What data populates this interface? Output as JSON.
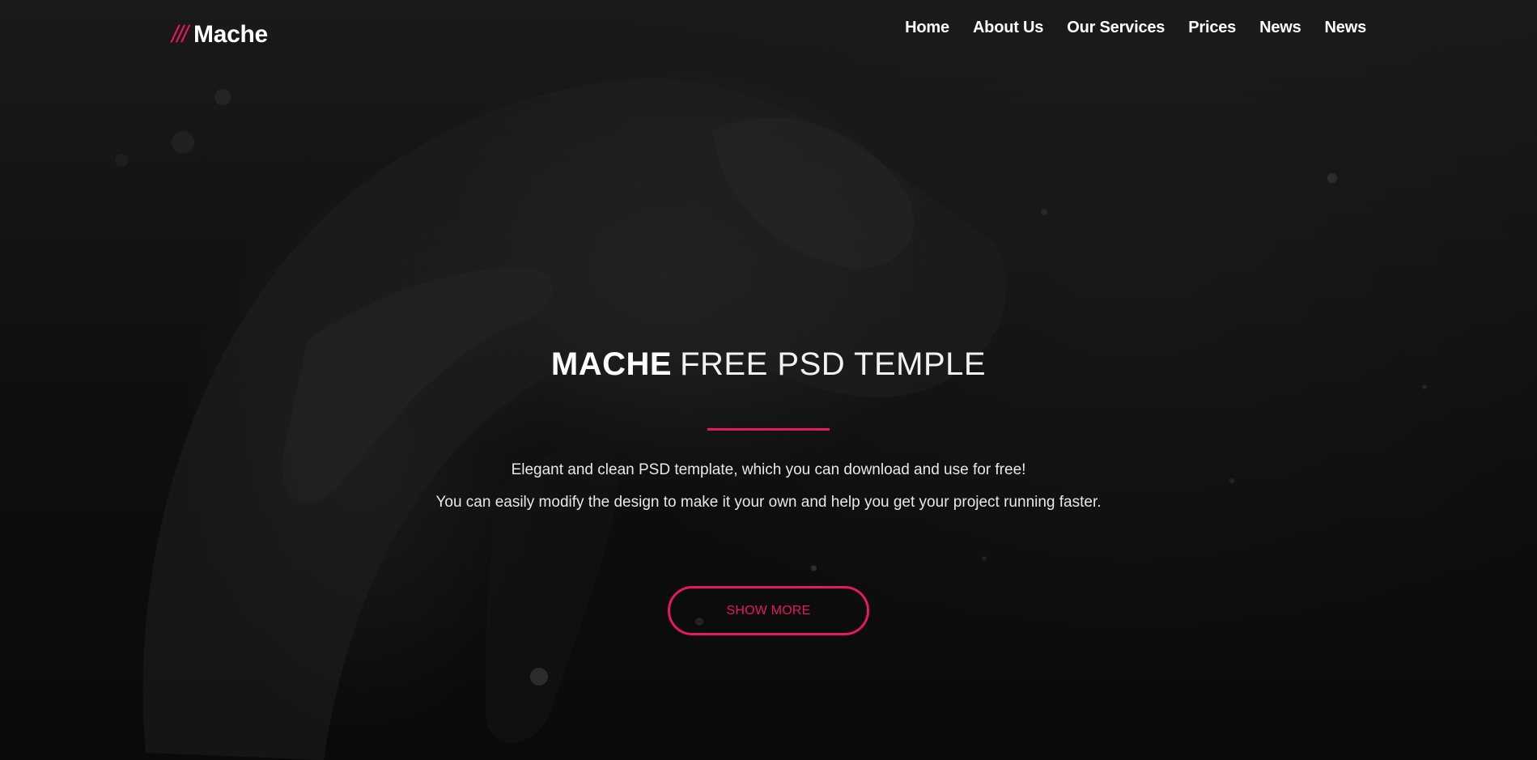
{
  "brand": {
    "slashes": "///",
    "name": "Mache"
  },
  "nav": [
    {
      "label": "Home"
    },
    {
      "label": "About Us"
    },
    {
      "label": "Our Services"
    },
    {
      "label": "Prices"
    },
    {
      "label": "News"
    },
    {
      "label": "News"
    }
  ],
  "hero": {
    "title_strong": "MACHE",
    "title_light": "FREE PSD TEMPLE",
    "description": [
      "Elegant and clean PSD template, which you can download and use for free!",
      "You can easily modify the design to make it your own and help you get your project running faster."
    ],
    "button_label": "SHOW MORE"
  },
  "colors": {
    "accent": "#e5195b",
    "background": "#141415",
    "text": "#ffffff"
  }
}
